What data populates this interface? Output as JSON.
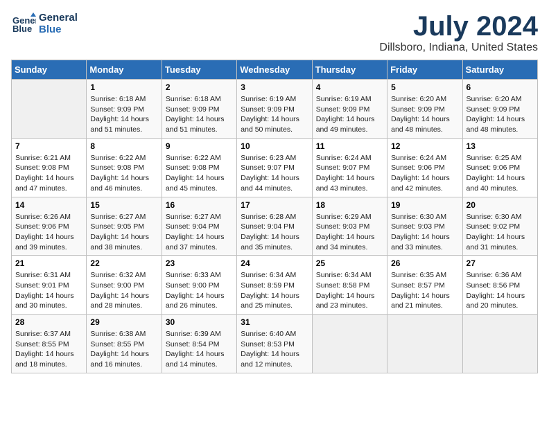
{
  "logo": {
    "line1": "General",
    "line2": "Blue"
  },
  "title": "July 2024",
  "subtitle": "Dillsboro, Indiana, United States",
  "days_header": [
    "Sunday",
    "Monday",
    "Tuesday",
    "Wednesday",
    "Thursday",
    "Friday",
    "Saturday"
  ],
  "weeks": [
    [
      {
        "day": "",
        "info": ""
      },
      {
        "day": "1",
        "info": "Sunrise: 6:18 AM\nSunset: 9:09 PM\nDaylight: 14 hours\nand 51 minutes."
      },
      {
        "day": "2",
        "info": "Sunrise: 6:18 AM\nSunset: 9:09 PM\nDaylight: 14 hours\nand 51 minutes."
      },
      {
        "day": "3",
        "info": "Sunrise: 6:19 AM\nSunset: 9:09 PM\nDaylight: 14 hours\nand 50 minutes."
      },
      {
        "day": "4",
        "info": "Sunrise: 6:19 AM\nSunset: 9:09 PM\nDaylight: 14 hours\nand 49 minutes."
      },
      {
        "day": "5",
        "info": "Sunrise: 6:20 AM\nSunset: 9:09 PM\nDaylight: 14 hours\nand 48 minutes."
      },
      {
        "day": "6",
        "info": "Sunrise: 6:20 AM\nSunset: 9:09 PM\nDaylight: 14 hours\nand 48 minutes."
      }
    ],
    [
      {
        "day": "7",
        "info": "Sunrise: 6:21 AM\nSunset: 9:08 PM\nDaylight: 14 hours\nand 47 minutes."
      },
      {
        "day": "8",
        "info": "Sunrise: 6:22 AM\nSunset: 9:08 PM\nDaylight: 14 hours\nand 46 minutes."
      },
      {
        "day": "9",
        "info": "Sunrise: 6:22 AM\nSunset: 9:08 PM\nDaylight: 14 hours\nand 45 minutes."
      },
      {
        "day": "10",
        "info": "Sunrise: 6:23 AM\nSunset: 9:07 PM\nDaylight: 14 hours\nand 44 minutes."
      },
      {
        "day": "11",
        "info": "Sunrise: 6:24 AM\nSunset: 9:07 PM\nDaylight: 14 hours\nand 43 minutes."
      },
      {
        "day": "12",
        "info": "Sunrise: 6:24 AM\nSunset: 9:06 PM\nDaylight: 14 hours\nand 42 minutes."
      },
      {
        "day": "13",
        "info": "Sunrise: 6:25 AM\nSunset: 9:06 PM\nDaylight: 14 hours\nand 40 minutes."
      }
    ],
    [
      {
        "day": "14",
        "info": "Sunrise: 6:26 AM\nSunset: 9:06 PM\nDaylight: 14 hours\nand 39 minutes."
      },
      {
        "day": "15",
        "info": "Sunrise: 6:27 AM\nSunset: 9:05 PM\nDaylight: 14 hours\nand 38 minutes."
      },
      {
        "day": "16",
        "info": "Sunrise: 6:27 AM\nSunset: 9:04 PM\nDaylight: 14 hours\nand 37 minutes."
      },
      {
        "day": "17",
        "info": "Sunrise: 6:28 AM\nSunset: 9:04 PM\nDaylight: 14 hours\nand 35 minutes."
      },
      {
        "day": "18",
        "info": "Sunrise: 6:29 AM\nSunset: 9:03 PM\nDaylight: 14 hours\nand 34 minutes."
      },
      {
        "day": "19",
        "info": "Sunrise: 6:30 AM\nSunset: 9:03 PM\nDaylight: 14 hours\nand 33 minutes."
      },
      {
        "day": "20",
        "info": "Sunrise: 6:30 AM\nSunset: 9:02 PM\nDaylight: 14 hours\nand 31 minutes."
      }
    ],
    [
      {
        "day": "21",
        "info": "Sunrise: 6:31 AM\nSunset: 9:01 PM\nDaylight: 14 hours\nand 30 minutes."
      },
      {
        "day": "22",
        "info": "Sunrise: 6:32 AM\nSunset: 9:00 PM\nDaylight: 14 hours\nand 28 minutes."
      },
      {
        "day": "23",
        "info": "Sunrise: 6:33 AM\nSunset: 9:00 PM\nDaylight: 14 hours\nand 26 minutes."
      },
      {
        "day": "24",
        "info": "Sunrise: 6:34 AM\nSunset: 8:59 PM\nDaylight: 14 hours\nand 25 minutes."
      },
      {
        "day": "25",
        "info": "Sunrise: 6:34 AM\nSunset: 8:58 PM\nDaylight: 14 hours\nand 23 minutes."
      },
      {
        "day": "26",
        "info": "Sunrise: 6:35 AM\nSunset: 8:57 PM\nDaylight: 14 hours\nand 21 minutes."
      },
      {
        "day": "27",
        "info": "Sunrise: 6:36 AM\nSunset: 8:56 PM\nDaylight: 14 hours\nand 20 minutes."
      }
    ],
    [
      {
        "day": "28",
        "info": "Sunrise: 6:37 AM\nSunset: 8:55 PM\nDaylight: 14 hours\nand 18 minutes."
      },
      {
        "day": "29",
        "info": "Sunrise: 6:38 AM\nSunset: 8:55 PM\nDaylight: 14 hours\nand 16 minutes."
      },
      {
        "day": "30",
        "info": "Sunrise: 6:39 AM\nSunset: 8:54 PM\nDaylight: 14 hours\nand 14 minutes."
      },
      {
        "day": "31",
        "info": "Sunrise: 6:40 AM\nSunset: 8:53 PM\nDaylight: 14 hours\nand 12 minutes."
      },
      {
        "day": "",
        "info": ""
      },
      {
        "day": "",
        "info": ""
      },
      {
        "day": "",
        "info": ""
      }
    ]
  ]
}
